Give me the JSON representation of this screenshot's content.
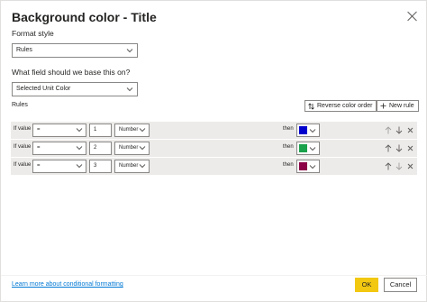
{
  "dialog": {
    "title": "Background color - Title"
  },
  "format_style": {
    "label": "Format style",
    "value": "Rules"
  },
  "base_field": {
    "label": "What field should we base this on?",
    "value": "Selected Unit Color"
  },
  "rules": {
    "label": "Rules",
    "reverse_label": "Reverse color order",
    "new_rule_label": "New rule",
    "items": [
      {
        "prefix": "If value",
        "operator": "=",
        "value": "1",
        "type": "Number",
        "then": "then",
        "color": "#0000cc"
      },
      {
        "prefix": "If value",
        "operator": "=",
        "value": "2",
        "type": "Number",
        "then": "then",
        "color": "#1aa14b"
      },
      {
        "prefix": "If value",
        "operator": "=",
        "value": "3",
        "type": "Number",
        "then": "then",
        "color": "#8b0046"
      }
    ]
  },
  "footer": {
    "learn_more": "Learn more about conditional formatting",
    "ok_label": "OK",
    "cancel_label": "Cancel"
  },
  "icons": {
    "close": "close-icon",
    "chevron": "chevron-down-icon",
    "reverse": "sort-arrows-icon",
    "add": "plus-icon",
    "up": "arrow-up-icon",
    "down": "arrow-down-icon",
    "delete": "delete-x-icon"
  }
}
